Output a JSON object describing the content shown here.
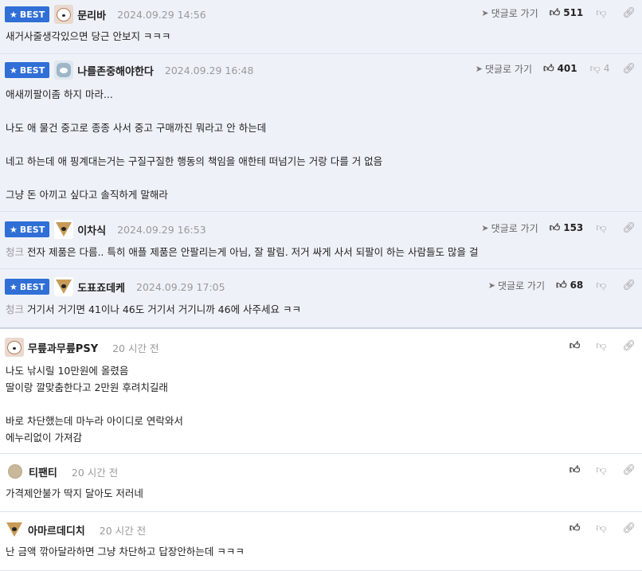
{
  "best_label": "BEST",
  "reply_label": "댓글로 가기",
  "comments": [
    {
      "nick": "문리바",
      "date": "2024.09.29 14:56",
      "likes": "511",
      "dislikes": "",
      "lines": [
        "새거사줄생각있으면 당근 안보지 ㅋㅋㅋ"
      ]
    },
    {
      "nick": "나를존중해야한다",
      "date": "2024.09.29 16:48",
      "likes": "401",
      "dislikes": "4",
      "lines": [
        "애새끼팔이좀 하지 마라...",
        "",
        "나도 애 물건 중고로 종종 사서 중고 구매까진 뭐라고 안 하는데",
        "",
        "네고 하는데 애 핑계대는거는 구질구질한 행동의 책임을 애한테 떠넘기는 거랑 다를 거 없음",
        "",
        "그냥 돈 아끼고 싶다고 솔직하게 말해라"
      ]
    },
    {
      "nick": "이차식",
      "date": "2024.09.29 16:53",
      "likes": "153",
      "dislikes": "",
      "prefix": "청크",
      "lines": [
        "전자 제품은 다름.. 특히 애플 제품은 안팔리는게 아님, 잘 팔림. 저거 싸게 사서 되팔이 하는 사람들도 많을 걸"
      ]
    },
    {
      "nick": "도표죠데케",
      "date": "2024.09.29 17:05",
      "likes": "68",
      "dislikes": "",
      "prefix": "청크",
      "lines": [
        "거기서 거기면 41이나 46도 거기서 거기니까 46에 사주세요 ㅋㅋ"
      ]
    },
    {
      "nick": "무릎과무릎PSY",
      "date": "20 시간 전",
      "lines": [
        "나도 낚시릴 10만원에 올렸음",
        "딸이랑 깔맞춤한다고 2만원 후려치길래",
        "",
        "바로 차단했는데 마누라 아이디로 연락와서",
        "에누리없이 가져감"
      ]
    },
    {
      "nick": "티팬티",
      "date": "20 시간 전",
      "lines": [
        "가격제안불가 딱지 달아도 저러네"
      ]
    },
    {
      "nick": "아마르데디치",
      "date": "20 시간 전",
      "lines": [
        "난 금액 깎아달라하면 그냥 차단하고 답장안하는데 ㅋㅋㅋ"
      ]
    }
  ],
  "icons": {
    "star": "star-icon",
    "reply": "paper-plane-icon",
    "like": "thumbs-up-icon",
    "dislike": "thumbs-down-icon",
    "share": "link-icon"
  }
}
